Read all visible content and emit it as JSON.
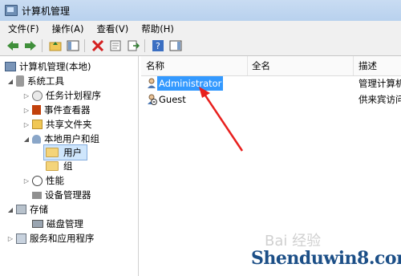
{
  "window": {
    "title": "计算机管理"
  },
  "menu": [
    "文件(F)",
    "操作(A)",
    "查看(V)",
    "帮助(H)"
  ],
  "toolbar_icons": [
    "back-arrow-icon",
    "forward-arrow-icon",
    "up-folder-icon",
    "show-hide-tree-icon",
    "delete-icon",
    "properties-icon",
    "export-list-icon",
    "help-icon",
    "show-hide-action-pane-icon"
  ],
  "tree": {
    "root": "计算机管理(本地)",
    "system_tools": "系统工具",
    "task_scheduler": "任务计划程序",
    "event_viewer": "事件查看器",
    "shared_folders": "共享文件夹",
    "local_users_groups": "本地用户和组",
    "users": "用户",
    "groups": "组",
    "performance": "性能",
    "device_manager": "设备管理器",
    "storage": "存储",
    "disk_management": "磁盘管理",
    "services_apps": "服务和应用程序"
  },
  "list": {
    "columns": [
      "名称",
      "全名",
      "描述"
    ],
    "rows": [
      {
        "name": "Administrator",
        "full_name": "",
        "description": "管理计算机(域"
      },
      {
        "name": "Guest",
        "full_name": "",
        "description": "供来宾访问计"
      }
    ]
  },
  "watermarks": {
    "baidu": "Bai 经验",
    "site": "Shenduwin8.com"
  },
  "colors": {
    "selection": "#3399ff",
    "arrow": "#e8201e"
  }
}
